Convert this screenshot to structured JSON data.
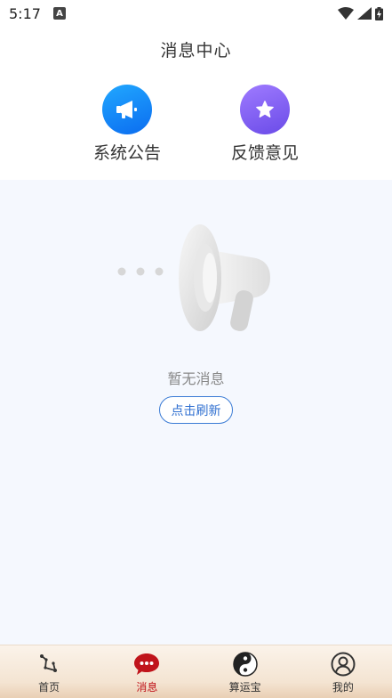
{
  "status": {
    "time": "5:17",
    "notification_icon": "A"
  },
  "header": {
    "title": "消息中心"
  },
  "shortcuts": [
    {
      "label": "系统公告",
      "icon": "megaphone-icon",
      "color": "#1a8cff"
    },
    {
      "label": "反馈意见",
      "icon": "star-icon",
      "color": "#7d5cf5"
    }
  ],
  "empty_state": {
    "text": "暂无消息",
    "refresh_label": "点击刷新"
  },
  "tabs": [
    {
      "label": "首页",
      "icon": "constellation-icon",
      "active": false
    },
    {
      "label": "消息",
      "icon": "chat-bubble-icon",
      "active": true
    },
    {
      "label": "算运宝",
      "icon": "yin-yang-icon",
      "active": false
    },
    {
      "label": "我的",
      "icon": "user-icon",
      "active": false
    }
  ],
  "colors": {
    "accent": "#c0141b",
    "link": "#2f6fd0",
    "background": "#f5f8fe"
  }
}
